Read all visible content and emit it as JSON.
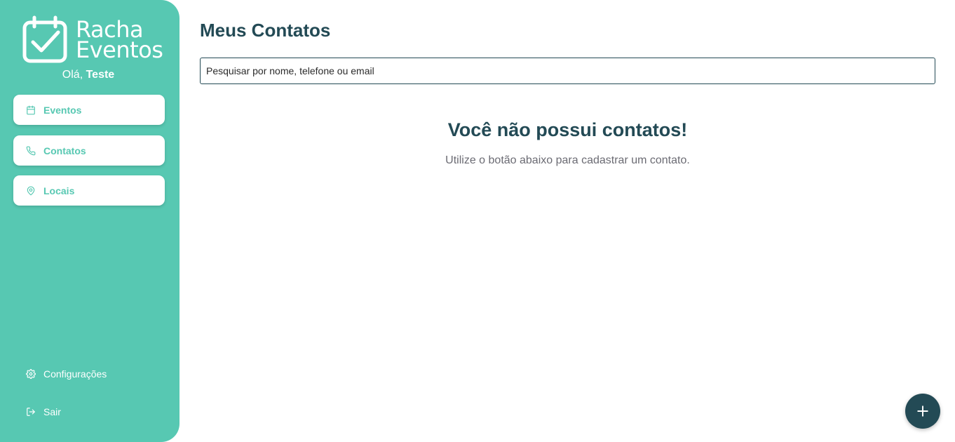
{
  "brand": {
    "line1": "Racha",
    "line2": "Eventos",
    "icon": "calendar-check-icon"
  },
  "greeting": {
    "prefix": "Olá,",
    "user": "Teste"
  },
  "sidebar": {
    "items": [
      {
        "label": "Eventos",
        "icon": "calendar-icon"
      },
      {
        "label": "Contatos",
        "icon": "phone-icon"
      },
      {
        "label": "Locais",
        "icon": "map-pin-icon"
      }
    ],
    "bottom": [
      {
        "label": "Configurações",
        "icon": "gear-icon"
      },
      {
        "label": "Sair",
        "icon": "logout-icon"
      }
    ]
  },
  "main": {
    "title": "Meus Contatos",
    "search": {
      "placeholder": "Pesquisar por nome, telefone ou email",
      "value": ""
    },
    "empty_state": {
      "title": "Você não possui contatos!",
      "subtitle": "Utilize o botão abaixo para cadastrar um contato."
    },
    "fab_icon": "plus-icon"
  },
  "colors": {
    "sidebar": "#57c8b2",
    "primary_dark": "#234a55",
    "muted_text": "#6b6b73",
    "white": "#ffffff"
  }
}
